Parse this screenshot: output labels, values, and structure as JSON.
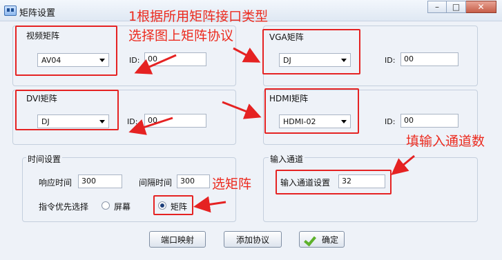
{
  "window": {
    "title": "矩阵设置"
  },
  "video_group": {
    "label": "视频矩阵",
    "protocol": "AV04",
    "id_label": "ID:",
    "id_value": "00"
  },
  "vga_group": {
    "label": "VGA矩阵",
    "protocol": "DJ",
    "id_label": "ID:",
    "id_value": "00"
  },
  "dvi_group": {
    "label": "DVI矩阵",
    "protocol": "DJ",
    "id_label": "ID:",
    "id_value": "00"
  },
  "hdmi_group": {
    "label": "HDMI矩阵",
    "protocol": "HDMI-02",
    "id_label": "ID:",
    "id_value": "00"
  },
  "time_group": {
    "label": "时间设置",
    "response_label": "响应时间",
    "response_value": "300",
    "interval_label": "间隔时间",
    "interval_value": "300",
    "priority_label": "指令优先选择",
    "option_screen": "屏幕",
    "option_matrix": "矩阵",
    "selected": "矩阵"
  },
  "input_group": {
    "label": "输入通道",
    "setting_label": "输入通道设置",
    "setting_value": "32"
  },
  "buttons": {
    "port_map": "端口映射",
    "add_protocol": "添加协议",
    "ok": "确定"
  },
  "annotations": {
    "line1": "1根据所用矩阵接口类型",
    "line2": "选择图上矩阵协议",
    "fill_channels": "填输入通道数",
    "select_matrix": "选矩阵",
    "color": "#ec2b1f"
  },
  "icons": [
    "app-icon",
    "minimize-icon",
    "maximize-icon",
    "close-icon",
    "checkmark-icon"
  ]
}
